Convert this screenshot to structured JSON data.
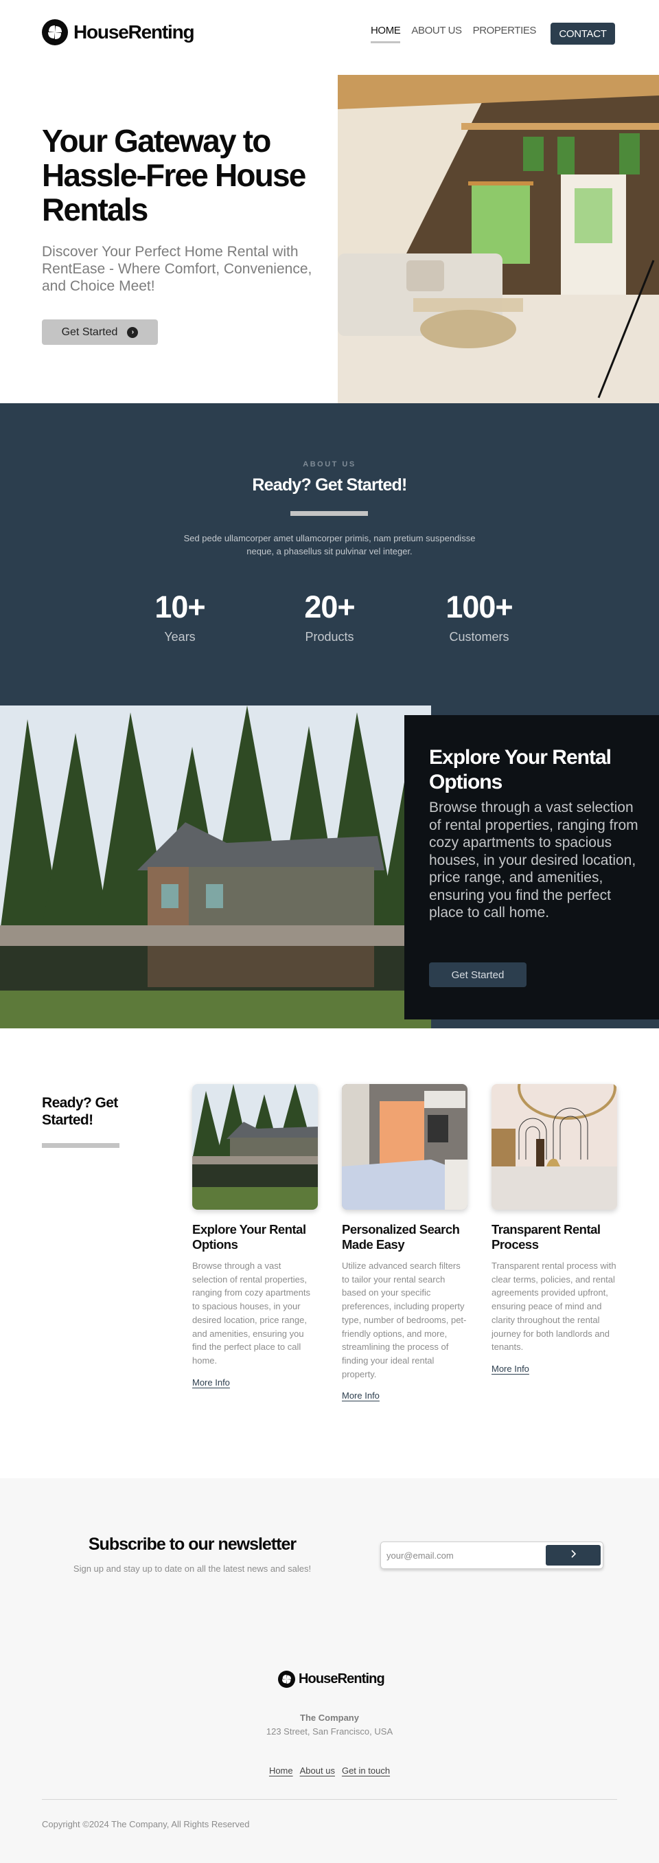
{
  "header": {
    "brand": "HouseRenting",
    "nav": [
      {
        "label": "HOME",
        "active": true
      },
      {
        "label": "ABOUT US",
        "active": false
      },
      {
        "label": "PROPERTIES",
        "active": false
      }
    ],
    "contact_label": "CONTACT"
  },
  "hero": {
    "title": "Your Gateway to Hassle-Free House Rentals",
    "subtitle": "Discover Your Perfect Home Rental with RentEase - Where Comfort, Convenience, and Choice Meet!",
    "cta_label": "Get Started",
    "cta_icon": "chevron-right-circle-icon",
    "image_alt": "A-frame cabin living room with white sofa and glass coffee table"
  },
  "about": {
    "eyebrow": "ABOUT US",
    "title": "Ready? Get Started!",
    "text": "Sed pede ullamcorper amet ullamcorper primis, nam pretium suspendisse neque, a phasellus sit pulvinar vel integer.",
    "stats": [
      {
        "value": "10+",
        "label": "Years"
      },
      {
        "value": "20+",
        "label": "Products"
      },
      {
        "value": "100+",
        "label": "Customers"
      }
    ]
  },
  "feature": {
    "image_alt": "Cabin house beside a pond surrounded by pine trees",
    "title": "Explore Your Rental Options",
    "text": "Browse through a vast selection of rental properties, ranging from cozy apartments to spacious houses, in your desired location, price range, and amenities, ensuring you find the perfect place to call home.",
    "cta_label": "Get Started"
  },
  "services": {
    "title": "Ready? Get Started!",
    "cards": [
      {
        "title": "Explore Your Rental Options",
        "text": "Browse through a vast selection of rental properties, ranging from cozy apartments to spacious houses, in your desired location, price range, and amenities, ensuring you find the perfect place to call home.",
        "link": "More Info",
        "image_alt": "Cabin by a pond"
      },
      {
        "title": "Personalized Search Made Easy",
        "text": "Utilize advanced search filters to tailor your rental search based on your specific preferences, including property type, number of bedrooms, pet-friendly options, and more, streamlining the process of finding your ideal rental property.",
        "link": "More Info",
        "image_alt": "Bedroom with orange curtains"
      },
      {
        "title": "Transparent Rental Process",
        "text": "Transparent rental process with clear terms, policies, and rental agreements provided upfront, ensuring peace of mind and clarity throughout the rental journey for both landlords and tenants.",
        "link": "More Info",
        "image_alt": "Bathroom sink with gold faucet"
      }
    ]
  },
  "newsletter": {
    "title": "Subscribe to our newsletter",
    "subtitle": "Sign up and stay up to date on all the latest news and sales!",
    "email_placeholder": "your@email.com",
    "email_value": "",
    "submit_icon": "chevron-right-icon"
  },
  "footer": {
    "brand": "HouseRenting",
    "company": "The Company",
    "address": "123 Street, San Francisco, USA",
    "links": [
      "Home",
      "About us",
      "Get in touch"
    ],
    "copyright": "Copyright ©2024 The Company, All Rights Reserved"
  },
  "colors": {
    "primary": "#2c3e4e",
    "dark_panel": "#0d1115",
    "accent_gray": "#c4c4c4",
    "muted_text": "#8c8c8c",
    "light_bg": "#f7f7f7"
  }
}
